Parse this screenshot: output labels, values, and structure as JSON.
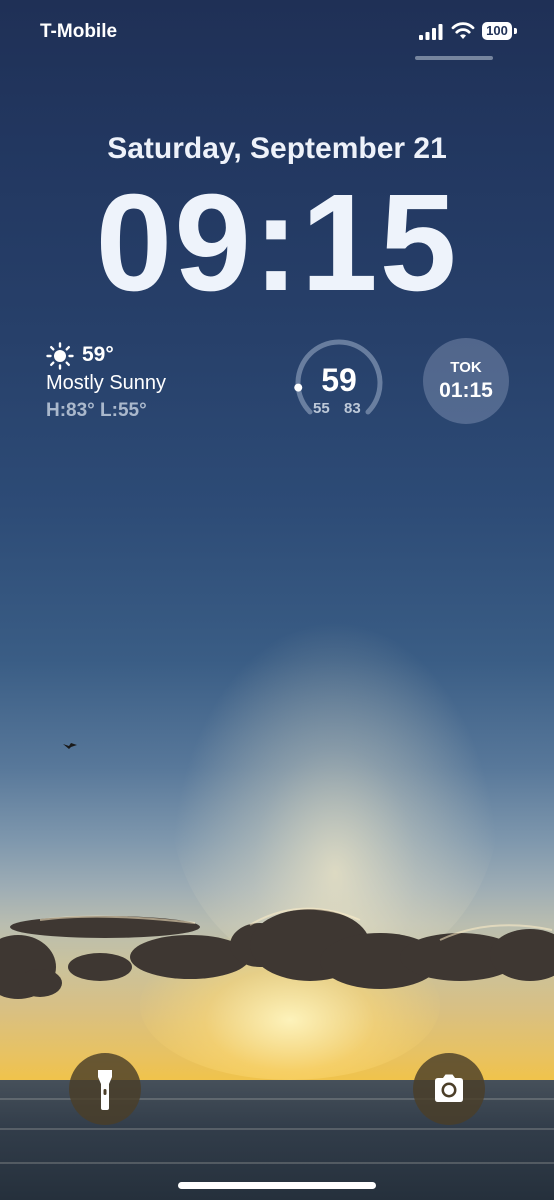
{
  "status_bar": {
    "carrier": "T-Mobile",
    "battery_level": "100",
    "icons": [
      "signal-bars-icon",
      "wifi-icon",
      "battery-icon"
    ]
  },
  "lock_screen": {
    "date": "Saturday, September 21",
    "time": "09:15"
  },
  "widgets": {
    "weather": {
      "icon": "sun-icon",
      "temperature": "59°",
      "condition": "Mostly Sunny",
      "high_low": "H:83° L:55°"
    },
    "temperature_gauge": {
      "current": "59",
      "min": "55",
      "max": "83",
      "current_value": 59,
      "min_value": 55,
      "max_value": 83
    },
    "world_clock": {
      "city": "TOK",
      "time": "01:15"
    }
  },
  "quick_actions": {
    "left": "flashlight-icon",
    "right": "camera-icon"
  },
  "colors": {
    "text_primary": "#ffffff",
    "sky_top": "#1f3056",
    "sunset_gold": "#f0c34b",
    "button_bg": "#4b3e28"
  }
}
